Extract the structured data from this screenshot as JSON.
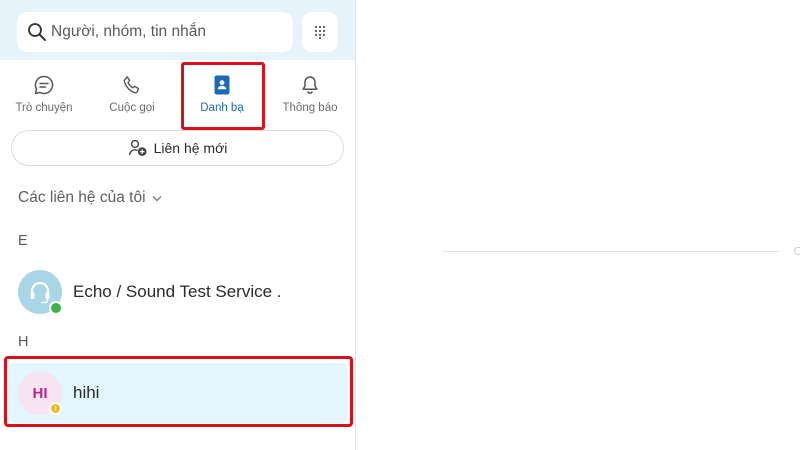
{
  "search": {
    "placeholder": "Người, nhóm, tin nhắn",
    "icon": "search-icon"
  },
  "dialpad": {
    "icon": "dialpad-icon"
  },
  "tabs": [
    {
      "label": "Trò chuyện",
      "icon": "chat-icon",
      "active": false
    },
    {
      "label": "Cuộc gọi",
      "icon": "phone-icon",
      "active": false
    },
    {
      "label": "Danh bạ",
      "icon": "contacts-book-icon",
      "active": true
    },
    {
      "label": "Thông báo",
      "icon": "bell-icon",
      "active": false
    }
  ],
  "new_contact": {
    "label": "Liên hệ mới",
    "icon": "add-person-icon"
  },
  "contacts_section": {
    "title": "Các liên hệ của tôi",
    "icon": "chevron-down-icon"
  },
  "groups": [
    {
      "letter": "E",
      "contacts": [
        {
          "name": "Echo / Sound Test Service .",
          "avatar_icon": "headset-icon",
          "status": "online",
          "status_color": "#3bb346"
        }
      ]
    },
    {
      "letter": "H",
      "contacts": [
        {
          "name": "hihi",
          "initials": "HI",
          "status": "pending",
          "status_color": "#f5b81c",
          "selected": true
        }
      ]
    }
  ],
  "colors": {
    "accent": "#1c69b5",
    "highlight_border": "#d8111b",
    "search_bg": "#e6f3fb",
    "selected_bg": "#e3f6fd"
  }
}
